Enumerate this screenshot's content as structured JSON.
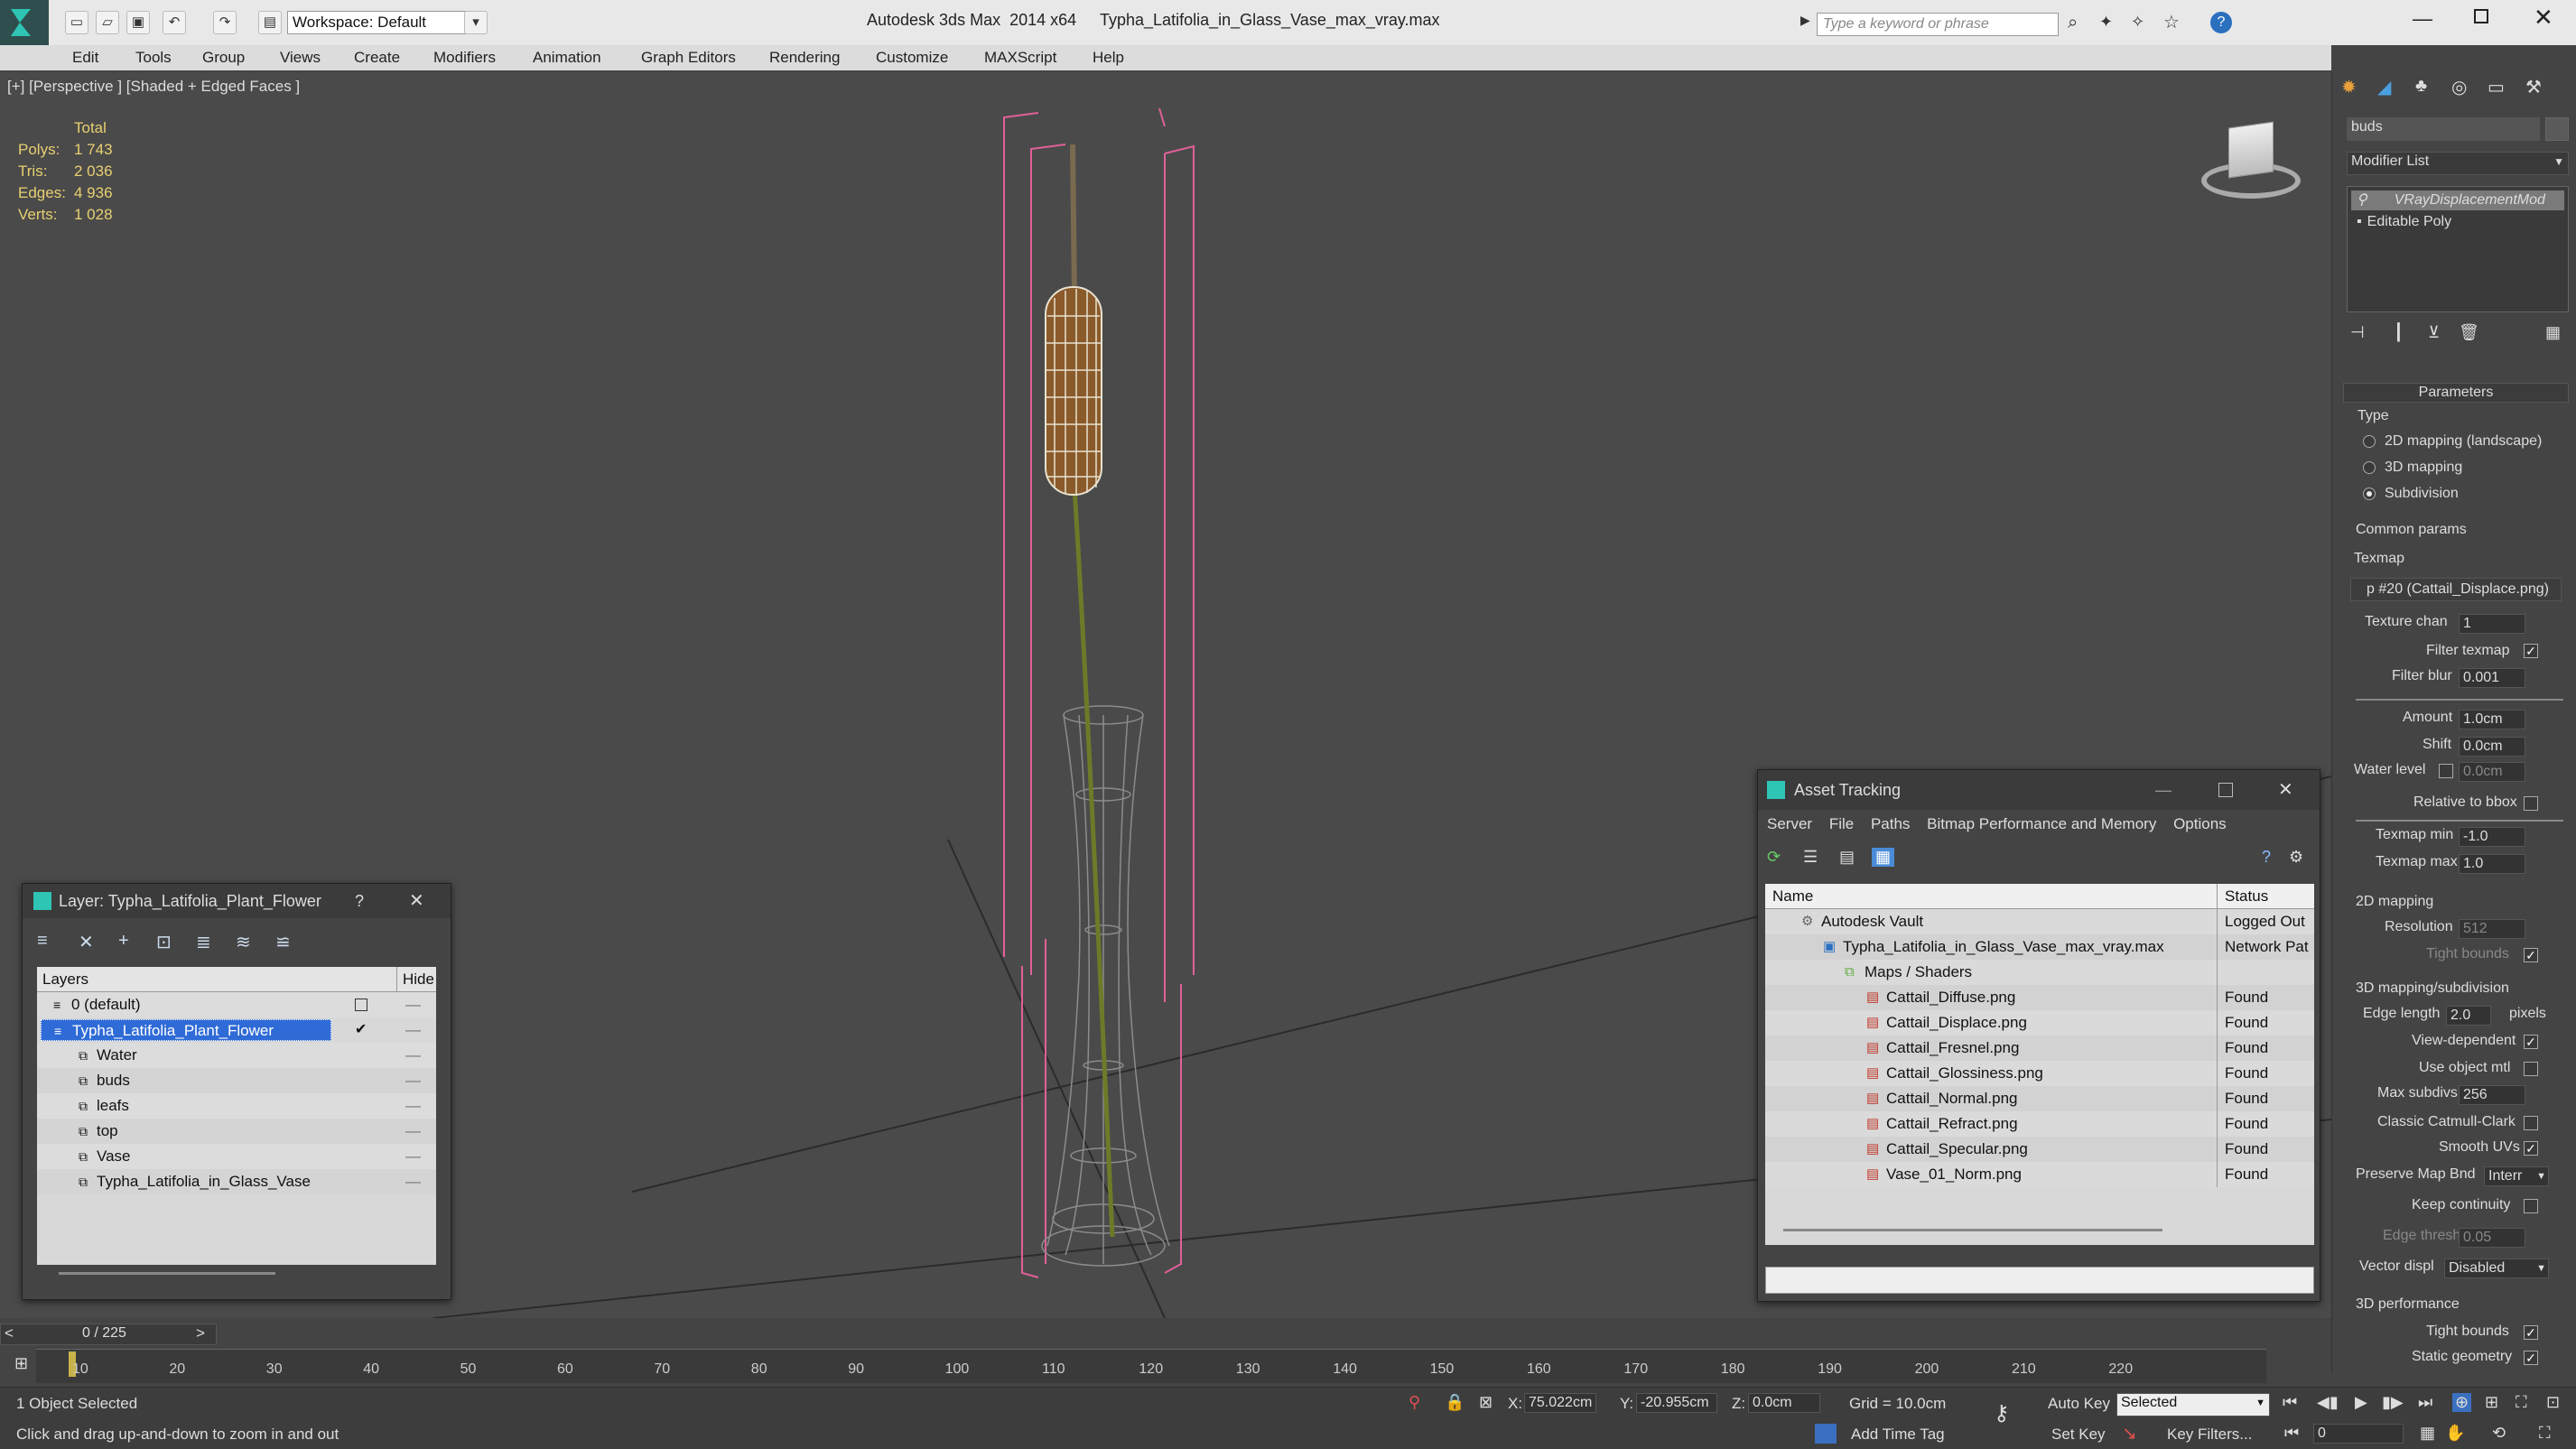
{
  "titlebar": {
    "workspace": "Workspace: Default",
    "app_title": "Autodesk 3ds Max  2014 x64",
    "file_title": "Typha_Latifolia_in_Glass_Vase_max_vray.max",
    "search_placeholder": "Type a keyword or phrase"
  },
  "menu": [
    "Edit",
    "Tools",
    "Group",
    "Views",
    "Create",
    "Modifiers",
    "Animation",
    "Graph Editors",
    "Rendering",
    "Customize",
    "MAXScript",
    "Help"
  ],
  "viewport": {
    "label": "[+] [Perspective ] [Shaded + Edged Faces ]",
    "stats": {
      "header": "Total",
      "rows": [
        {
          "label": "Polys:",
          "value": "1 743"
        },
        {
          "label": "Tris:",
          "value": "2 036"
        },
        {
          "label": "Edges:",
          "value": "4 936"
        },
        {
          "label": "Verts:",
          "value": "1 028"
        }
      ]
    }
  },
  "layer_window": {
    "title": "Layer: Typha_Latifolia_Plant_Flower",
    "help": "?",
    "col_layers": "Layers",
    "col_hide": "Hide",
    "rows": [
      {
        "name": "0 (default)",
        "indent": 0,
        "selected": false,
        "check": "box"
      },
      {
        "name": "Typha_Latifolia_Plant_Flower",
        "indent": 0,
        "selected": true,
        "check": "tick"
      },
      {
        "name": "Water",
        "indent": 1,
        "selected": false,
        "check": ""
      },
      {
        "name": "buds",
        "indent": 1,
        "selected": false,
        "check": ""
      },
      {
        "name": "leafs",
        "indent": 1,
        "selected": false,
        "check": ""
      },
      {
        "name": "top",
        "indent": 1,
        "selected": false,
        "check": ""
      },
      {
        "name": "Vase",
        "indent": 1,
        "selected": false,
        "check": ""
      },
      {
        "name": "Typha_Latifolia_in_Glass_Vase",
        "indent": 1,
        "selected": false,
        "check": ""
      }
    ]
  },
  "asset_window": {
    "title": "Asset Tracking",
    "menu": [
      "Server",
      "File",
      "Paths",
      "Bitmap Performance and Memory",
      "Options"
    ],
    "col_name": "Name",
    "col_status": "Status",
    "rows": [
      {
        "name": "Autodesk Vault",
        "status": "Logged Out",
        "indent": 0,
        "icon": "vault"
      },
      {
        "name": "Typha_Latifolia_in_Glass_Vase_max_vray.max",
        "status": "Network Pat",
        "indent": 1,
        "icon": "max"
      },
      {
        "name": "Maps / Shaders",
        "status": "",
        "indent": 2,
        "icon": "maps"
      },
      {
        "name": "Cattail_Diffuse.png",
        "status": "Found",
        "indent": 3,
        "icon": "png"
      },
      {
        "name": "Cattail_Displace.png",
        "status": "Found",
        "indent": 3,
        "icon": "png"
      },
      {
        "name": "Cattail_Fresnel.png",
        "status": "Found",
        "indent": 3,
        "icon": "png"
      },
      {
        "name": "Cattail_Glossiness.png",
        "status": "Found",
        "indent": 3,
        "icon": "png"
      },
      {
        "name": "Cattail_Normal.png",
        "status": "Found",
        "indent": 3,
        "icon": "png"
      },
      {
        "name": "Cattail_Refract.png",
        "status": "Found",
        "indent": 3,
        "icon": "png"
      },
      {
        "name": "Cattail_Specular.png",
        "status": "Found",
        "indent": 3,
        "icon": "png"
      },
      {
        "name": "Vase_01_Norm.png",
        "status": "Found",
        "indent": 3,
        "icon": "png"
      }
    ]
  },
  "command_panel": {
    "object_name": "buds",
    "modifier_list": "Modifier List",
    "stack": [
      "VRayDisplacementMod",
      "Editable Poly"
    ],
    "params_title": "Parameters",
    "type_label": "Type",
    "type_options": [
      "2D mapping (landscape)",
      "3D mapping",
      "Subdivision"
    ],
    "type_selected": 2,
    "common_params": "Common params",
    "texmap_label": "Texmap",
    "texmap_value": "p #20 (Cattail_Displace.png)",
    "texture_chan_label": "Texture chan",
    "texture_chan": "1",
    "filter_texmap": "Filter texmap",
    "filter_blur_label": "Filter blur",
    "filter_blur": "0.001",
    "amount_label": "Amount",
    "amount": "1.0cm",
    "shift_label": "Shift",
    "shift": "0.0cm",
    "water_level_label": "Water level",
    "water_level": "0.0cm",
    "relative_bbox": "Relative to bbox",
    "texmap_min_label": "Texmap min",
    "texmap_min": "-1.0",
    "texmap_max_label": "Texmap max",
    "texmap_max": "1.0",
    "mapping2d": "2D mapping",
    "resolution_label": "Resolution",
    "resolution": "512",
    "tight_bounds": "Tight bounds",
    "mapping3d": "3D mapping/subdivision",
    "edge_length_label": "Edge length",
    "edge_length": "2.0",
    "pixels": "pixels",
    "view_dependent": "View-dependent",
    "use_object_mtl": "Use object mtl",
    "max_subdivs_label": "Max subdivs",
    "max_subdivs": "256",
    "classic_catmull": "Classic Catmull-Clark",
    "smooth_uvs": "Smooth UVs",
    "preserve_label": "Preserve Map Bnd",
    "preserve_value": "Interr",
    "keep_continuity": "Keep continuity",
    "edge_thresh_label": "Edge thresh",
    "edge_thresh": "0.05",
    "vector_displ_label": "Vector displ",
    "vector_displ": "Disabled",
    "perf_label": "3D performance",
    "tight_bounds2": "Tight bounds",
    "static_geometry": "Static geometry"
  },
  "timeline": {
    "frame": "0 / 225",
    "ticks": [
      "10",
      "20",
      "30",
      "40",
      "50",
      "60",
      "70",
      "80",
      "90",
      "100",
      "110",
      "120",
      "130",
      "140",
      "150",
      "160",
      "170",
      "180",
      "190",
      "200",
      "210",
      "220"
    ]
  },
  "status": {
    "selected": "1 Object Selected",
    "hint": "Click and drag up-and-down to zoom in and out",
    "x_label": "X:",
    "x": "75.022cm",
    "y_label": "Y:",
    "y": "-20.955cm",
    "z_label": "Z:",
    "z": "0.0cm",
    "grid": "Grid = 10.0cm",
    "add_time_tag": "Add Time Tag",
    "auto_key": "Auto Key",
    "set_key": "Set Key",
    "key_mode": "Selected",
    "key_filters": "Key Filters...",
    "frame_field": "0"
  }
}
